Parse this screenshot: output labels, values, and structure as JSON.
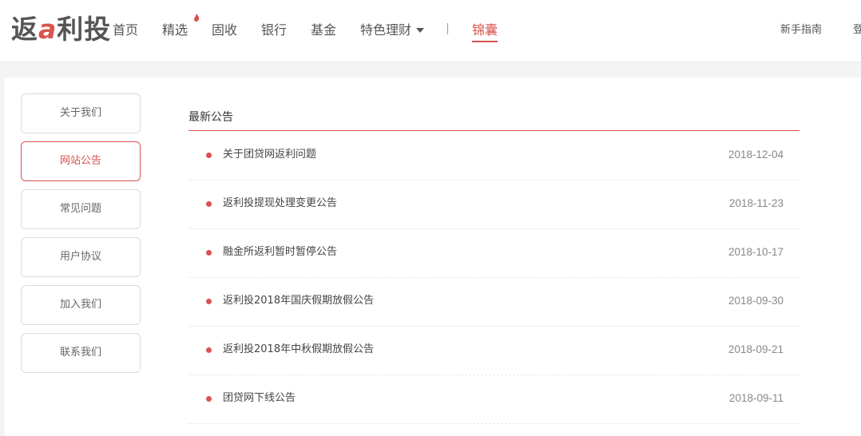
{
  "header": {
    "logo": {
      "prefix": "返",
      "accent": "a",
      "suffix": "利投"
    },
    "nav": [
      {
        "label": "首页"
      },
      {
        "label": "精选"
      },
      {
        "label": "固收"
      },
      {
        "label": "银行"
      },
      {
        "label": "基金"
      },
      {
        "label": "特色理财"
      },
      {
        "label": "锦囊"
      }
    ],
    "guide_label": "新手指南",
    "login_label": "登",
    "active_nav": "锦囊",
    "hot_icon": "flame-icon"
  },
  "sidebar": {
    "items": [
      {
        "label": "关于我们"
      },
      {
        "label": "网站公告"
      },
      {
        "label": "常见问题"
      },
      {
        "label": "用户协议"
      },
      {
        "label": "加入我们"
      },
      {
        "label": "联系我们"
      }
    ],
    "active": "网站公告"
  },
  "main": {
    "title": "最新公告",
    "announcements": [
      {
        "title": "关于团贷网返利问题",
        "date": "2018-12-04"
      },
      {
        "title": "返利投提现处理变更公告",
        "date": "2018-11-23"
      },
      {
        "title": "融金所返利暂时暂停公告",
        "date": "2018-10-17"
      },
      {
        "title": "返利投2018年国庆假期放假公告",
        "date": "2018-09-30"
      },
      {
        "title": "返利投2018年中秋假期放假公告",
        "date": "2018-09-21"
      },
      {
        "title": "团贷网下线公告",
        "date": "2018-09-11"
      }
    ]
  },
  "colors": {
    "accent": "#d9534f",
    "text": "#444444",
    "muted": "#888888"
  }
}
